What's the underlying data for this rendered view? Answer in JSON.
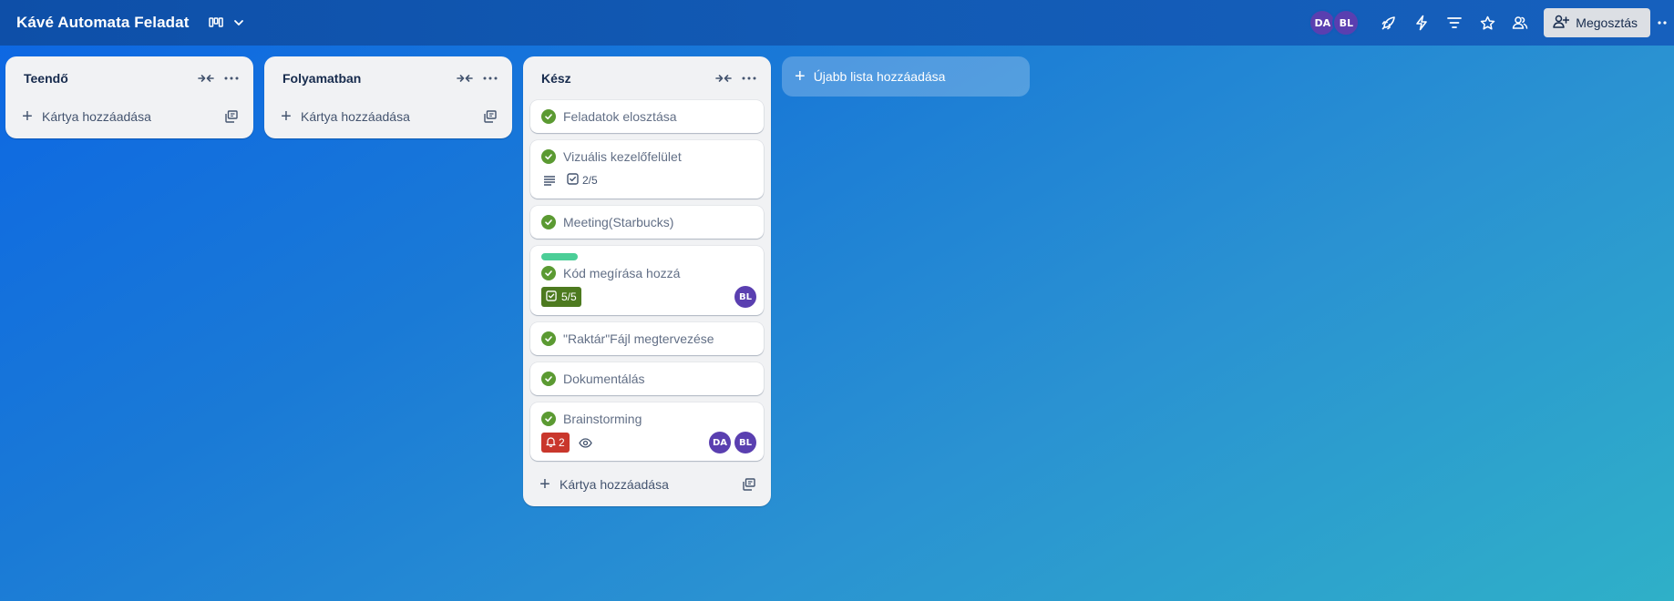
{
  "header": {
    "board_title": "Kávé Automata Feladat",
    "view_icon": "board-view-icon",
    "members": [
      "DA",
      "BL"
    ],
    "icons": [
      "power-ups-icon",
      "automation-icon",
      "filter-icon",
      "star-icon",
      "visibility-icon"
    ],
    "share_label": "Megosztás"
  },
  "lists": [
    {
      "title": "Teendő",
      "add_card_label": "Kártya hozzáadása",
      "cards": []
    },
    {
      "title": "Folyamatban",
      "add_card_label": "Kártya hozzáadása",
      "cards": []
    },
    {
      "title": "Kész",
      "add_card_label": "Kártya hozzáadása",
      "cards": [
        {
          "title": "Feladatok elosztása"
        },
        {
          "title": "Vizuális kezelőfelület",
          "checklist": "2/5"
        },
        {
          "title": "Meeting(Starbucks)"
        },
        {
          "title": "Kód megírása hozzá",
          "checklist": "5/5",
          "member": "BL"
        },
        {
          "title": "\"Raktár\"Fájl megtervezése"
        },
        {
          "title": "Dokumentálás"
        },
        {
          "title": "Brainstorming",
          "notifications": "2",
          "members": [
            "DA",
            "BL"
          ]
        }
      ]
    }
  ],
  "add_list_label": "Újabb lista hozzáadása",
  "colors": {
    "header": "#125ab4",
    "avatar": "#5a3fb0",
    "check": "#5b9a32",
    "checklist_complete": "#4d7a1f",
    "notification": "#c9372c",
    "label_green": "#4bce97"
  }
}
